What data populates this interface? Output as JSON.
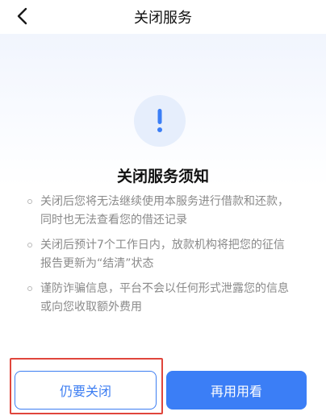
{
  "header": {
    "title": "关闭服务",
    "back_icon": "chevron-left-icon"
  },
  "notice": {
    "icon": "exclamation-icon",
    "accent_color": "#3b7ef6",
    "heading": "关闭服务须知",
    "items": [
      {
        "text": "关闭后您将无法继续使用本服务进行借款和还款，同时也无法查看您的借还记录"
      },
      {
        "text": "关闭后预计7个工作日内，放款机构将把您的征信报告更新为“结清”状态"
      },
      {
        "text": "谨防诈骗信息，平台不会以任何形式泄露您的信息或向您收取额外费用"
      }
    ]
  },
  "actions": {
    "confirm_close_label": "仍要关闭",
    "keep_using_label": "再用用看",
    "highlight_color": "#e0463c"
  }
}
